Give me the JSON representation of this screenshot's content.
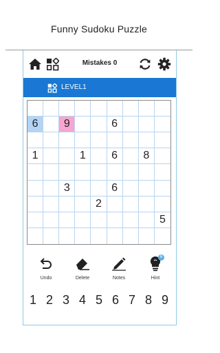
{
  "app_title": "Funny Sudoku Puzzle",
  "toolbar": {
    "home_icon": "home-icon",
    "levels_icon": "grid-apps-icon",
    "mistakes_label": "Mistakes 0",
    "restart_icon": "refresh-icon",
    "settings_icon": "gear-icon"
  },
  "level": {
    "label": "LEVEL1",
    "icon": "grid-apps-icon",
    "bar_color": "#1a78d4"
  },
  "board": {
    "rows": [
      [
        "",
        "",
        "",
        "",
        "",
        "",
        "",
        "",
        ""
      ],
      [
        "6",
        "",
        "9",
        "",
        "",
        "6",
        "",
        "",
        ""
      ],
      [
        "",
        "",
        "",
        "",
        "",
        "",
        "",
        "",
        ""
      ],
      [
        "1",
        "",
        "",
        "1",
        "",
        "6",
        "",
        "8",
        ""
      ],
      [
        "",
        "",
        "",
        "",
        "",
        "",
        "",
        "",
        ""
      ],
      [
        "",
        "",
        "3",
        "",
        "",
        "6",
        "",
        "",
        ""
      ],
      [
        "",
        "",
        "",
        "",
        "2",
        "",
        "",
        "",
        ""
      ],
      [
        "",
        "",
        "",
        "",
        "",
        "",
        "",
        "",
        "5"
      ],
      [
        "",
        "",
        "",
        "",
        "",
        "",
        "",
        "",
        ""
      ]
    ],
    "selected_color": "#b3d4f5",
    "error_color": "#f6a6cf"
  },
  "tools": {
    "undo_label": "Undo",
    "delete_label": "Delete",
    "notes_label": "Notes",
    "hint_label": "Hint",
    "hint_count": "6"
  },
  "numbers": [
    "1",
    "2",
    "3",
    "4",
    "5",
    "6",
    "7",
    "8",
    "9"
  ]
}
